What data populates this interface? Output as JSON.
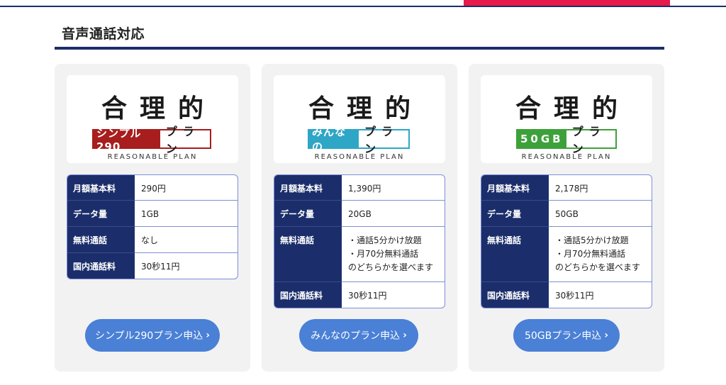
{
  "section": {
    "title": "音声通話対応"
  },
  "colors": {
    "navy": "#1b2e6b",
    "accent": "#e8194b",
    "button": "#4a80d6",
    "card_bg": "#f2f2f3"
  },
  "cards": [
    {
      "logo": {
        "title": "合理的",
        "tag": "シンプル290",
        "plan": "プラン",
        "subtitle": "REASONABLE PLAN",
        "tag_color": "#a81d1d"
      },
      "rows": [
        {
          "key": "月額基本料",
          "val": [
            "290円"
          ]
        },
        {
          "key": "データ量",
          "val": [
            "1GB"
          ]
        },
        {
          "key": "無料通話",
          "val": [
            "なし"
          ]
        },
        {
          "key": "国内通話料",
          "val": [
            "30秒11円"
          ]
        }
      ],
      "button": "シンプル290プラン申込",
      "chevron": "›"
    },
    {
      "logo": {
        "title": "合理的",
        "tag": "みんなの",
        "plan": "プラン",
        "subtitle": "REASONABLE PLAN",
        "tag_color": "#2ea6c6"
      },
      "rows": [
        {
          "key": "月額基本料",
          "val": [
            "1,390円"
          ]
        },
        {
          "key": "データ量",
          "val": [
            "20GB"
          ]
        },
        {
          "key": "無料通話",
          "val": [
            "・通話5分かけ放題",
            "・月70分無料通話",
            "のどちらかを選べます"
          ]
        },
        {
          "key": "国内通話料",
          "val": [
            "30秒11円"
          ]
        }
      ],
      "button": "みんなのプラン申込",
      "chevron": "›"
    },
    {
      "logo": {
        "title": "合理的",
        "tag": "50GB",
        "plan": "プラン",
        "subtitle": "REASONABLE PLAN",
        "tag_color": "#3da13a"
      },
      "rows": [
        {
          "key": "月額基本料",
          "val": [
            "2,178円"
          ]
        },
        {
          "key": "データ量",
          "val": [
            "50GB"
          ]
        },
        {
          "key": "無料通話",
          "val": [
            "・通話5分かけ放題",
            "・月70分無料通話",
            "のどちらかを選べます"
          ]
        },
        {
          "key": "国内通話料",
          "val": [
            "30秒11円"
          ]
        }
      ],
      "button": "50GBプラン申込",
      "chevron": "›"
    }
  ]
}
